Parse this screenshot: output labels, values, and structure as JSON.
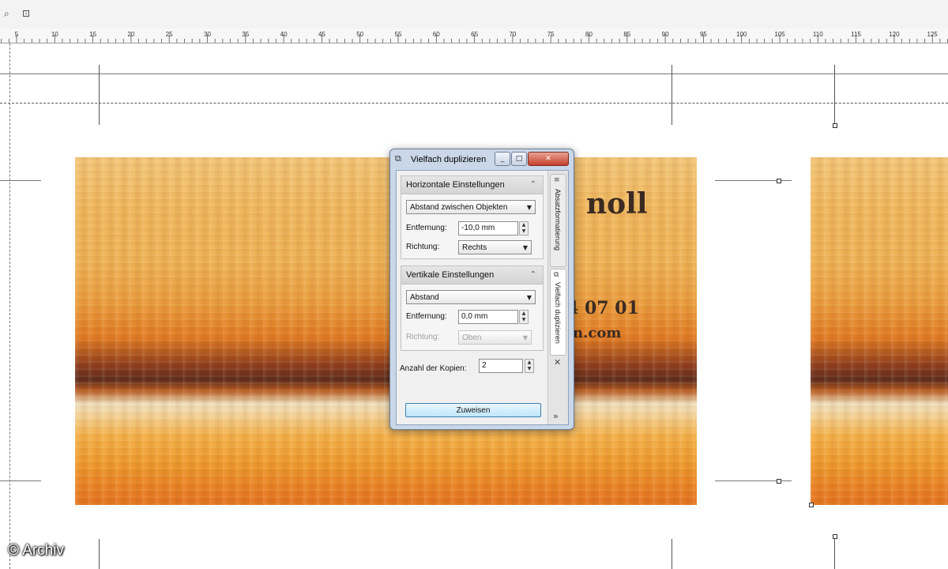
{
  "toolbar": {
    "icons": [
      "zoom-tool-icon",
      "zoom-fit-icon"
    ]
  },
  "ruler": {
    "ticks": [
      "5",
      "10",
      "15",
      "20",
      "25",
      "30",
      "35",
      "40",
      "45",
      "50",
      "55",
      "60",
      "65",
      "70",
      "75",
      "80",
      "85",
      "90",
      "95",
      "100",
      "105",
      "110",
      "115",
      "120",
      "125"
    ]
  },
  "card": {
    "name_partial": "noll",
    "phone_partial": "/4 07 01",
    "web_partial": "n.com"
  },
  "dialog": {
    "title": "Vielfach duplizieren",
    "window_buttons": [
      "minimize",
      "maximize",
      "close"
    ],
    "horizontal": {
      "header": "Horizontale Einstellungen",
      "mode": "Abstand zwischen Objekten",
      "distance_label": "Entfernung:",
      "distance_value": "-10,0 mm",
      "direction_label": "Richtung:",
      "direction_value": "Rechts"
    },
    "vertical": {
      "header": "Vertikale Einstellungen",
      "mode": "Abstand",
      "distance_label": "Entfernung:",
      "distance_value": "0,0 mm",
      "direction_label": "Richtung:",
      "direction_value": "Oben"
    },
    "copies_label": "Anzahl der Kopien:",
    "copies_value": "2",
    "apply_button": "Zuweisen",
    "side_tabs": [
      "Absatzformatierung",
      "Vielfach duplizieren"
    ]
  },
  "watermark": "© Archiv"
}
